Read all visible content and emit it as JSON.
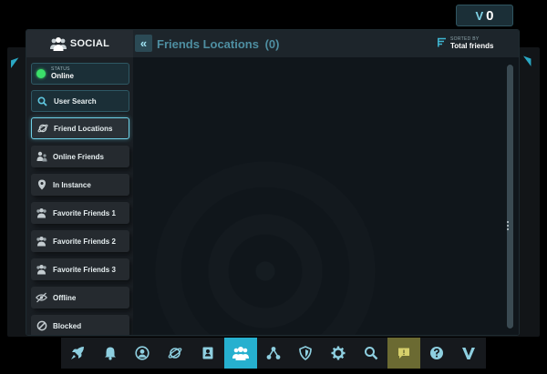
{
  "credits": {
    "amount": "0",
    "icon": "vrc-v-icon"
  },
  "sidebar": {
    "title": "SOCIAL",
    "status": {
      "caption": "STATUS",
      "value": "Online",
      "color": "#3be06a"
    },
    "items": [
      {
        "id": "user-search",
        "label": "User Search",
        "icon": "search-icon"
      },
      {
        "id": "friend-locations",
        "label": "Friend Locations",
        "icon": "planet-icon",
        "selected": true
      },
      {
        "id": "online-friends",
        "label": "Online Friends",
        "icon": "users-icon"
      },
      {
        "id": "in-instance",
        "label": "In Instance",
        "icon": "location-pin-icon"
      },
      {
        "id": "favorite-friends-1",
        "label": "Favorite Friends 1",
        "icon": "group-icon"
      },
      {
        "id": "favorite-friends-2",
        "label": "Favorite Friends 2",
        "icon": "group-icon"
      },
      {
        "id": "favorite-friends-3",
        "label": "Favorite Friends 3",
        "icon": "group-icon"
      },
      {
        "id": "offline",
        "label": "Offline",
        "icon": "eye-off-icon"
      },
      {
        "id": "blocked",
        "label": "Blocked",
        "icon": "blocked-icon"
      }
    ]
  },
  "content": {
    "title": "Friends Locations",
    "count": "(0)",
    "sort": {
      "caption": "SORTED BY",
      "value": "Total friends"
    }
  },
  "bottom_bar": [
    {
      "id": "launch",
      "icon": "rocket-icon"
    },
    {
      "id": "notifications",
      "icon": "bell-icon"
    },
    {
      "id": "profile",
      "icon": "user-circle-icon"
    },
    {
      "id": "worlds",
      "icon": "planet-icon"
    },
    {
      "id": "avatars",
      "icon": "avatar-book-icon"
    },
    {
      "id": "social",
      "icon": "social-icon",
      "active": true
    },
    {
      "id": "groups",
      "icon": "network-icon"
    },
    {
      "id": "safety",
      "icon": "shield-icon"
    },
    {
      "id": "settings",
      "icon": "gear-icon"
    },
    {
      "id": "search",
      "icon": "search-icon"
    },
    {
      "id": "feedback",
      "icon": "feedback-icon"
    },
    {
      "id": "help",
      "icon": "help-icon"
    },
    {
      "id": "vrchat",
      "icon": "vrc-v-icon"
    }
  ],
  "colors": {
    "accent": "#26b0cf",
    "selected_border": "#6fd0e6",
    "title": "#4e8ea1",
    "online": "#3be06a"
  }
}
